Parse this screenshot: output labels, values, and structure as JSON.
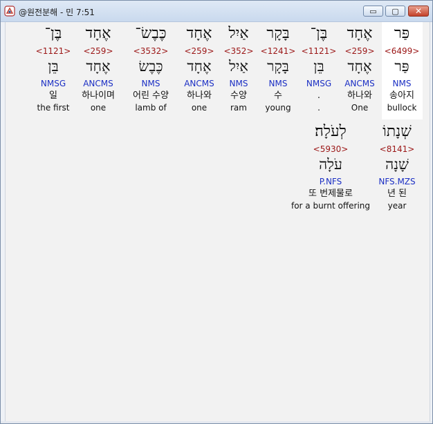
{
  "window": {
    "title": "@원전분해 - 민 7:51",
    "buttons": {
      "minimize": "▭",
      "maximize": "▢",
      "close": "✕"
    },
    "icon": "app-logo-icon"
  },
  "words": [
    {
      "heb": "פַּר",
      "strong": "<6499>",
      "lemma": "פַּר",
      "morph": "NMS",
      "korean": "송아지",
      "english": "bullock"
    },
    {
      "heb": "אֶחָד",
      "strong": "<259>",
      "lemma": "אֶחָד",
      "morph": "ANCMS",
      "korean": "하나와",
      "english": "One"
    },
    {
      "heb": "בֶּן־",
      "strong": "<1121>",
      "lemma": "בֵּן",
      "morph": "NMSG",
      "korean": ".",
      "english": "."
    },
    {
      "heb": "בָּקָר",
      "strong": "<1241>",
      "lemma": "בָּקָר",
      "morph": "NMS",
      "korean": "수",
      "english": "young"
    },
    {
      "heb": "אַיִל",
      "strong": "<352>",
      "lemma": "אַיִל",
      "morph": "NMS",
      "korean": "수양",
      "english": "ram"
    },
    {
      "heb": "אֶחָד",
      "strong": "<259>",
      "lemma": "אֶחָד",
      "morph": "ANCMS",
      "korean": "하나와",
      "english": "one"
    },
    {
      "heb": "כֶּבֶשׂ־",
      "strong": "<3532>",
      "lemma": "כֶּבֶשׂ",
      "morph": "NMS",
      "korean": "어린 수양",
      "english": "lamb of"
    },
    {
      "heb": "אֶחָד",
      "strong": "<259>",
      "lemma": "אֶחָד",
      "morph": "ANCMS",
      "korean": "하나이며",
      "english": "one"
    },
    {
      "heb": "בֶּן־",
      "strong": "<1121>",
      "lemma": "בֵּן",
      "morph": "NMSG",
      "korean": "일",
      "english": "the first"
    },
    {
      "heb": "שְׁנָתוֹ",
      "strong": "<8141>",
      "lemma": "שָׁנָה",
      "morph": "NFS.MZS",
      "korean": "년 된",
      "english": "year"
    },
    {
      "heb": "לְעֹלָה׃",
      "strong": "<5930>",
      "lemma": "עֹלָה",
      "morph": "P.NFS",
      "korean": "또 번제물로",
      "english": "for a burnt offering"
    }
  ]
}
